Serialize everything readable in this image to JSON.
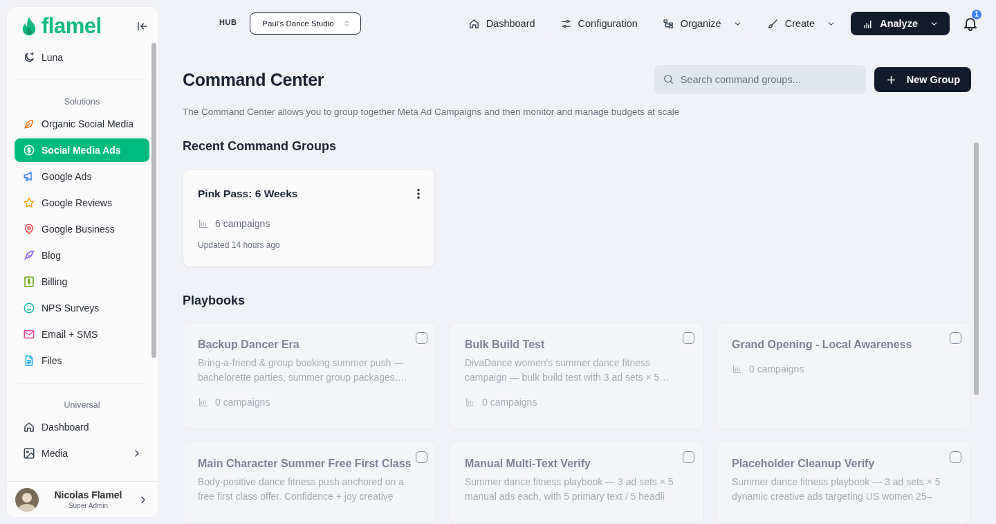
{
  "sidebar": {
    "logo": "flamel",
    "top_items": [
      {
        "label": "Luna",
        "selected": false
      }
    ],
    "sections": [
      {
        "title": "Solutions",
        "items": [
          {
            "label": "Organic Social Media",
            "selected": false
          },
          {
            "label": "Social Media Ads",
            "selected": true
          },
          {
            "label": "Google Ads",
            "selected": false
          },
          {
            "label": "Google Reviews",
            "selected": false
          },
          {
            "label": "Google Business",
            "selected": false
          },
          {
            "label": "Blog",
            "selected": false
          },
          {
            "label": "Billing",
            "selected": false
          },
          {
            "label": "NPS Surveys",
            "selected": false
          },
          {
            "label": "Email + SMS",
            "selected": false
          },
          {
            "label": "Files",
            "selected": false
          }
        ]
      },
      {
        "title": "Universal",
        "items": [
          {
            "label": "Dashboard",
            "selected": false,
            "kind": "link"
          },
          {
            "label": "Media",
            "selected": false,
            "kind": "submenu"
          }
        ]
      }
    ],
    "user": {
      "name": "Nicolas Flamel",
      "role": "Super Admin"
    }
  },
  "topbar": {
    "hub_label": "HUB",
    "hub_select": "Paul's Dance Studio",
    "nav": [
      {
        "label": "Dashboard",
        "kind": "link",
        "selected": false
      },
      {
        "label": "Configuration",
        "kind": "link",
        "selected": false
      },
      {
        "label": "Organize",
        "kind": "menu",
        "selected": false
      },
      {
        "label": "Create",
        "kind": "menu",
        "selected": false
      },
      {
        "label": "Analyze",
        "kind": "menu",
        "selected": true
      }
    ],
    "notifications": "1"
  },
  "header": {
    "title": "Command Center",
    "search_placeholder": "Search command groups...",
    "new_button": "New Group",
    "description": "The Command Center allows you to group together Meta Ad Campaigns and then monitor and manage budgets at scale"
  },
  "recent": {
    "heading": "Recent Command Groups",
    "cards": [
      {
        "title": "Pink Pass: 6 Weeks",
        "campaigns": "6 campaigns",
        "updated": "Updated 14 hours ago"
      }
    ]
  },
  "playbooks": {
    "heading": "Playbooks",
    "cards": [
      {
        "title": "Backup Dancer Era",
        "description": "Bring-a-friend & group booking summer push — bachelorette parties, summer group packages,…",
        "campaigns": "0 campaigns",
        "checked": false
      },
      {
        "title": "Bulk Build Test",
        "description": "DivaDance women's summer dance fitness campaign — bulk build test with 3 ad sets × 5…",
        "campaigns": "0 campaigns",
        "checked": false
      },
      {
        "title": "Grand Opening - Local Awareness",
        "campaigns": "0 campaigns",
        "checked": false
      },
      {
        "title": "Main Character Summer Free First Class",
        "description": "Body-positive dance fitness push anchored on a free first class offer. Confidence + joy creative",
        "checked": false
      },
      {
        "title": "Manual Multi-Text Verify",
        "description": "Summer dance fitness playbook — 3 ad sets × 5 manual ads each, with 5 primary text / 5 headli",
        "checked": false
      },
      {
        "title": "Placeholder Cleanup Verify",
        "description": "Summer dance fitness playbook — 3 ad sets × 5 dynamic creative ads targeting US women 25–",
        "checked": false
      }
    ]
  }
}
